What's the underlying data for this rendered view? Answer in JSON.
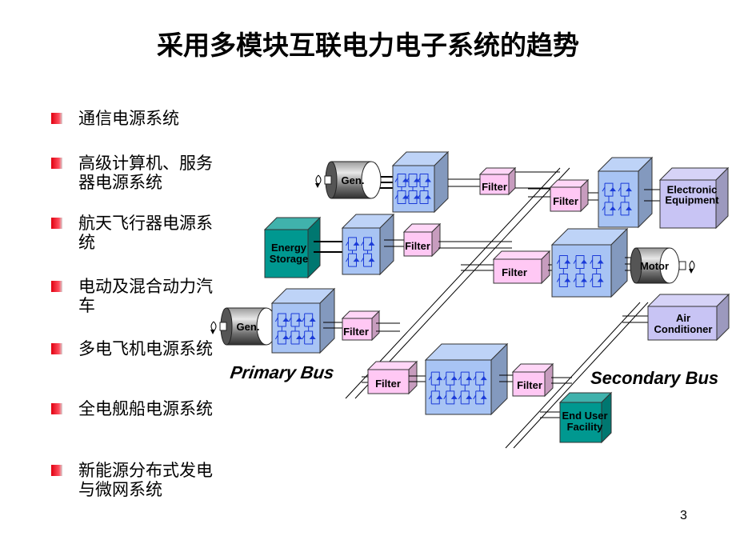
{
  "title": "采用多模块互联电力电子系统的趋势",
  "bullets": [
    "通信电源系统",
    "高级计算机、服务器电源系统",
    "航天飞行器电源系统",
    "电动及混合动力汽车",
    "多电飞机电源系统",
    "全电舰船电源系统",
    "新能源分布式发电与微网系统"
  ],
  "diagram": {
    "generator_label": "Gen.",
    "motor_label": "Motor",
    "filter_label": "Filter",
    "energy_storage_label": [
      "Energy",
      "Storage"
    ],
    "electronic_equipment_label": [
      "Electronic",
      "Equipment"
    ],
    "air_conditioner_label": [
      "Air",
      "Conditioner"
    ],
    "end_user_label": [
      "End User",
      "Facility"
    ],
    "primary_bus_label": "Primary Bus",
    "secondary_bus_label": "Secondary Bus",
    "colors": {
      "converter": "#a8c4f4",
      "filter": "#ffc8f4",
      "teal": "#009890",
      "load": "#c8c4f4",
      "switch": "#1a3ad8"
    }
  },
  "page_number": "3"
}
